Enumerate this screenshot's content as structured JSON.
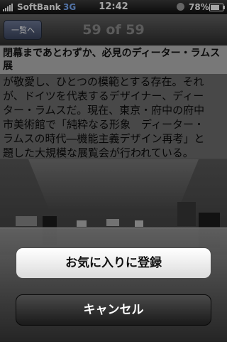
{
  "status_bar": {
    "carrier": "SoftBank",
    "network": "3G",
    "time": "12:42",
    "battery_percent": "78%",
    "battery_level": 0.78
  },
  "nav": {
    "back_label": "一覧へ",
    "title": "59 of 59"
  },
  "article": {
    "headline_line1": "閉幕まであとわずか、必見のディーター・ラムス",
    "headline_line2": "展",
    "body_lines": [
      "が敬愛し、ひとつの模範とする存在。それ",
      "が、ドイツを代表するデザイナー、ディー",
      "ター・ラムスだ。現在、東京・府中の府中",
      "市美術館で「純粋なる形象　ディーター・",
      "ラムスの時代―機能主義デザイン再考」と",
      "題した大規模な展覧会が行われている。"
    ]
  },
  "action_sheet": {
    "favorite_label": "お気に入りに登録",
    "cancel_label": "キャンセル"
  },
  "colors": {
    "sheet_button_light": "#f0f0f0",
    "sheet_button_dark": "#2a2a2a",
    "back_button": "#4c5878"
  }
}
